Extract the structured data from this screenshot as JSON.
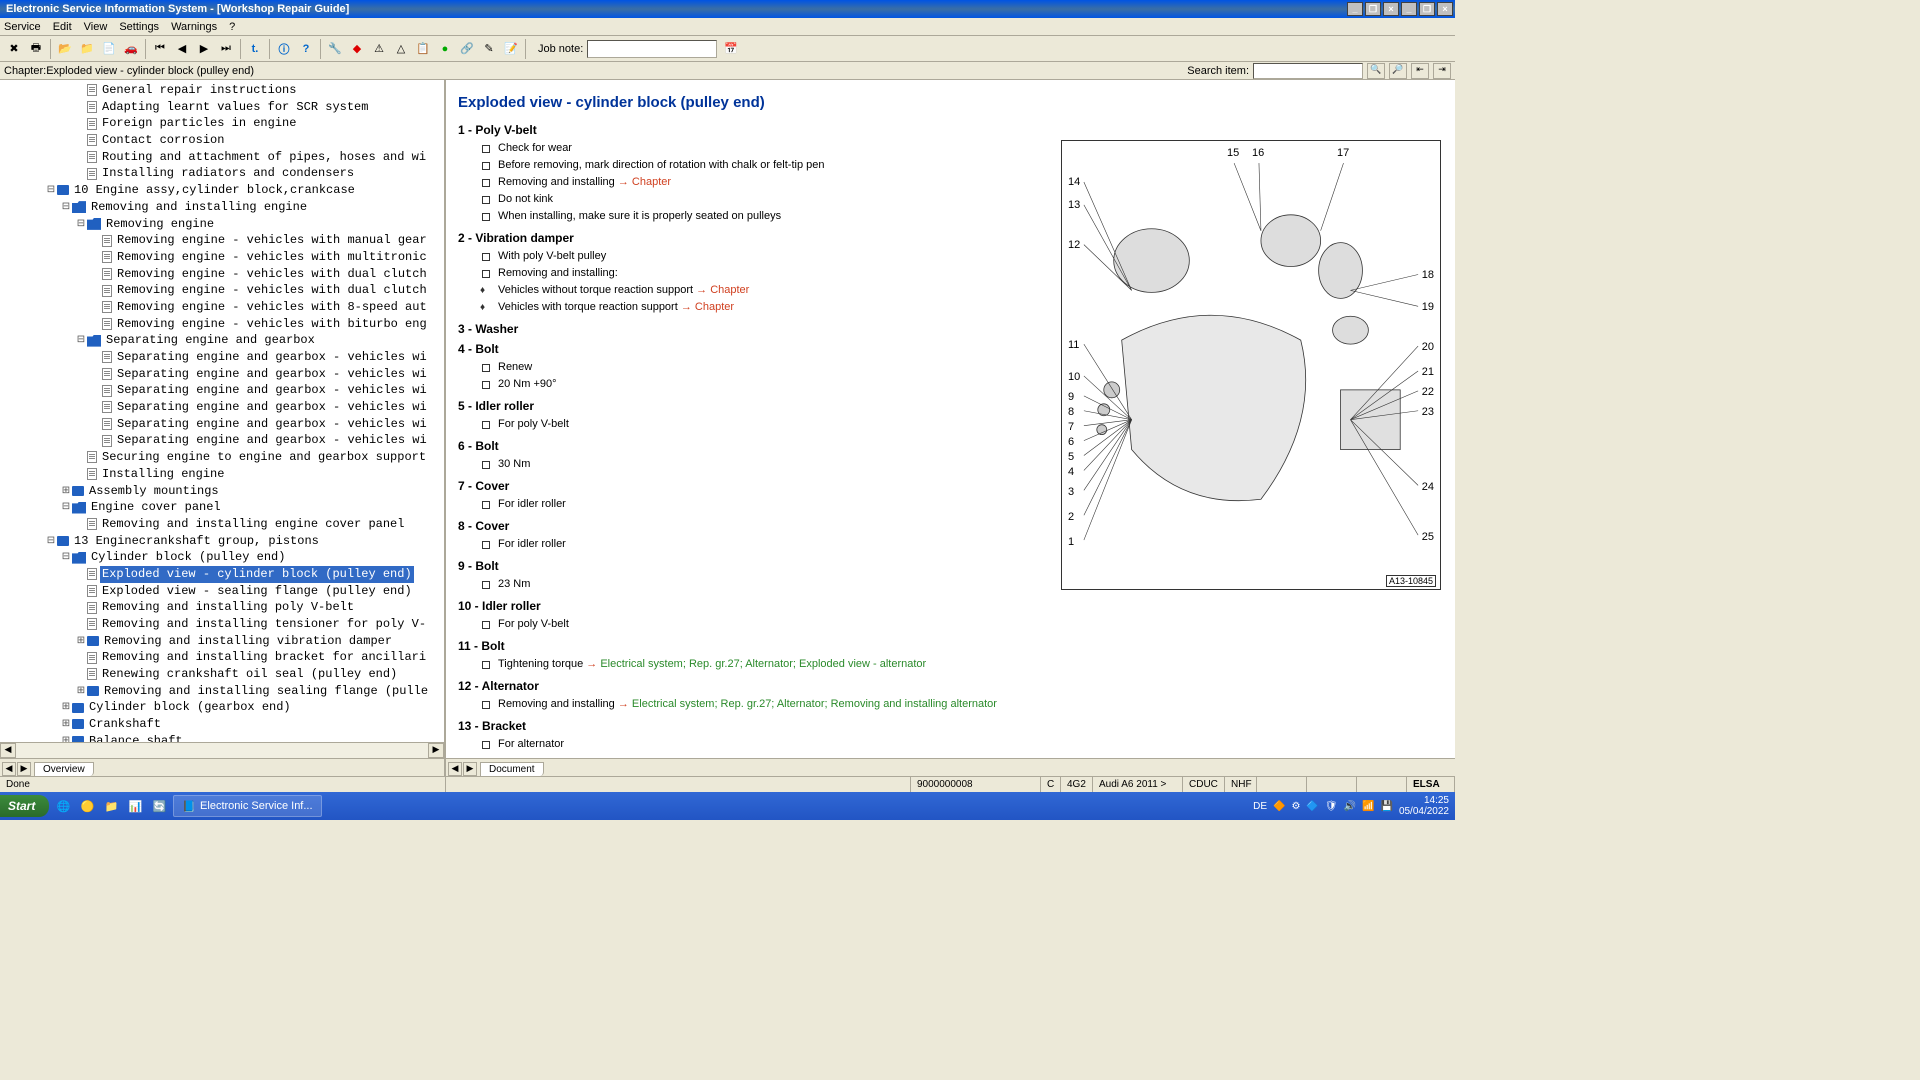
{
  "window": {
    "title": "Electronic Service Information System - [Workshop Repair Guide]"
  },
  "menu": [
    "Service",
    "Edit",
    "View",
    "Settings",
    "Warnings",
    "?"
  ],
  "toolbar": {
    "jobnote_label": "Job note:"
  },
  "chapter": {
    "label": "Chapter:Exploded view - cylinder block (pulley end)",
    "search_label": "Search item:"
  },
  "tree": [
    {
      "lvl": 3,
      "tw": "",
      "ic": "doc",
      "t": "General repair instructions"
    },
    {
      "lvl": 3,
      "tw": "",
      "ic": "doc",
      "t": "Adapting learnt values for SCR system"
    },
    {
      "lvl": 3,
      "tw": "",
      "ic": "doc",
      "t": "Foreign particles in engine"
    },
    {
      "lvl": 3,
      "tw": "",
      "ic": "doc",
      "t": "Contact corrosion"
    },
    {
      "lvl": 3,
      "tw": "",
      "ic": "doc",
      "t": "Routing and attachment of pipes, hoses and wi"
    },
    {
      "lvl": 3,
      "tw": "",
      "ic": "doc",
      "t": "Installing radiators and condensers"
    },
    {
      "lvl": 1,
      "tw": "−",
      "ic": "book",
      "t": "10 Engine assy,cylinder block,crankcase"
    },
    {
      "lvl": 2,
      "tw": "−",
      "ic": "folder",
      "t": "Removing and installing engine"
    },
    {
      "lvl": 3,
      "tw": "−",
      "ic": "folder",
      "t": "Removing engine"
    },
    {
      "lvl": 4,
      "tw": "",
      "ic": "doc",
      "t": "Removing engine - vehicles with manual gear"
    },
    {
      "lvl": 4,
      "tw": "",
      "ic": "doc",
      "t": "Removing engine - vehicles with multitronic"
    },
    {
      "lvl": 4,
      "tw": "",
      "ic": "doc",
      "t": "Removing engine - vehicles with dual clutch"
    },
    {
      "lvl": 4,
      "tw": "",
      "ic": "doc",
      "t": "Removing engine - vehicles with dual clutch"
    },
    {
      "lvl": 4,
      "tw": "",
      "ic": "doc",
      "t": "Removing engine - vehicles with 8-speed aut"
    },
    {
      "lvl": 4,
      "tw": "",
      "ic": "doc",
      "t": "Removing engine - vehicles with biturbo eng"
    },
    {
      "lvl": 3,
      "tw": "−",
      "ic": "folder",
      "t": "Separating engine and gearbox"
    },
    {
      "lvl": 4,
      "tw": "",
      "ic": "doc",
      "t": "Separating engine and gearbox - vehicles wi"
    },
    {
      "lvl": 4,
      "tw": "",
      "ic": "doc",
      "t": "Separating engine and gearbox - vehicles wi"
    },
    {
      "lvl": 4,
      "tw": "",
      "ic": "doc",
      "t": "Separating engine and gearbox - vehicles wi"
    },
    {
      "lvl": 4,
      "tw": "",
      "ic": "doc",
      "t": "Separating engine and gearbox - vehicles wi"
    },
    {
      "lvl": 4,
      "tw": "",
      "ic": "doc",
      "t": "Separating engine and gearbox - vehicles wi"
    },
    {
      "lvl": 4,
      "tw": "",
      "ic": "doc",
      "t": "Separating engine and gearbox - vehicles wi"
    },
    {
      "lvl": 3,
      "tw": "",
      "ic": "doc",
      "t": "Securing engine to engine and gearbox support"
    },
    {
      "lvl": 3,
      "tw": "",
      "ic": "doc",
      "t": "Installing engine"
    },
    {
      "lvl": 2,
      "tw": "+",
      "ic": "book",
      "t": "Assembly mountings"
    },
    {
      "lvl": 2,
      "tw": "−",
      "ic": "folder",
      "t": "Engine cover panel"
    },
    {
      "lvl": 3,
      "tw": "",
      "ic": "doc",
      "t": "Removing and installing engine cover panel"
    },
    {
      "lvl": 1,
      "tw": "−",
      "ic": "book",
      "t": "13 Enginecrankshaft group, pistons"
    },
    {
      "lvl": 2,
      "tw": "−",
      "ic": "folder",
      "t": "Cylinder block (pulley end)"
    },
    {
      "lvl": 3,
      "tw": "",
      "ic": "doc",
      "t": "Exploded view - cylinder block (pulley end)",
      "sel": true
    },
    {
      "lvl": 3,
      "tw": "",
      "ic": "doc",
      "t": "Exploded view - sealing flange (pulley end)"
    },
    {
      "lvl": 3,
      "tw": "",
      "ic": "doc",
      "t": "Removing and installing poly V-belt"
    },
    {
      "lvl": 3,
      "tw": "",
      "ic": "doc",
      "t": "Removing and installing tensioner for poly V-"
    },
    {
      "lvl": 3,
      "tw": "+",
      "ic": "book",
      "t": "Removing and installing vibration damper"
    },
    {
      "lvl": 3,
      "tw": "",
      "ic": "doc",
      "t": "Removing and installing bracket for ancillari"
    },
    {
      "lvl": 3,
      "tw": "",
      "ic": "doc",
      "t": "Renewing crankshaft oil seal (pulley end)"
    },
    {
      "lvl": 3,
      "tw": "+",
      "ic": "book",
      "t": "Removing and installing sealing flange (pulle"
    },
    {
      "lvl": 2,
      "tw": "+",
      "ic": "book",
      "t": "Cylinder block (gearbox end)"
    },
    {
      "lvl": 2,
      "tw": "+",
      "ic": "book",
      "t": "Crankshaft"
    },
    {
      "lvl": 2,
      "tw": "+",
      "ic": "book",
      "t": "Balance shaft"
    }
  ],
  "left_tab": "Overview",
  "right_tab": "Document",
  "doc": {
    "title": "Exploded view - cylinder block (pulley end)",
    "parts": [
      {
        "n": "1",
        "name": "Poly V-belt",
        "items": [
          {
            "t": "Check for wear",
            "b": "sq"
          },
          {
            "t": "Before removing, mark direction of rotation with chalk or felt-tip pen",
            "b": "sq"
          },
          {
            "t": "Removing and installing ",
            "link": "Chapter",
            "b": "sq",
            "arrow": true
          },
          {
            "t": "Do not kink",
            "b": "sq"
          },
          {
            "t": "When installing, make sure it is properly seated on pulleys",
            "b": "sq"
          }
        ]
      },
      {
        "n": "2",
        "name": "Vibration damper",
        "items": [
          {
            "t": "With poly V-belt pulley",
            "b": "sq"
          },
          {
            "t": "Removing and installing:",
            "b": "sq"
          },
          {
            "t": "Vehicles without torque reaction support ",
            "link": "Chapter",
            "b": "di",
            "arrow": true
          },
          {
            "t": "Vehicles with torque reaction support ",
            "link": "Chapter",
            "b": "di",
            "arrow": true
          }
        ]
      },
      {
        "n": "3",
        "name": "Washer",
        "items": []
      },
      {
        "n": "4",
        "name": "Bolt",
        "items": [
          {
            "t": "Renew",
            "b": "sq"
          },
          {
            "t": "20 Nm +90°",
            "b": "sq"
          }
        ]
      },
      {
        "n": "5",
        "name": "Idler roller",
        "items": [
          {
            "t": "For poly V-belt",
            "b": "sq"
          }
        ]
      },
      {
        "n": "6",
        "name": "Bolt",
        "items": [
          {
            "t": "30 Nm",
            "b": "sq"
          }
        ]
      },
      {
        "n": "7",
        "name": "Cover",
        "items": [
          {
            "t": "For idler roller",
            "b": "sq"
          }
        ]
      },
      {
        "n": "8",
        "name": "Cover",
        "items": [
          {
            "t": "For idler roller",
            "b": "sq"
          }
        ]
      },
      {
        "n": "9",
        "name": "Bolt",
        "items": [
          {
            "t": "23 Nm",
            "b": "sq"
          }
        ]
      },
      {
        "n": "10",
        "name": "Idler roller",
        "items": [
          {
            "t": "For poly V-belt",
            "b": "sq"
          }
        ]
      },
      {
        "n": "11",
        "name": "Bolt",
        "items": [
          {
            "t": "Tightening torque ",
            "link2": "Electrical system; Rep. gr.27; Alternator; Exploded view - alternator",
            "b": "sq",
            "arrow": true
          }
        ]
      },
      {
        "n": "12",
        "name": "Alternator",
        "items": [
          {
            "t": "Removing and installing ",
            "link2": "Electrical system; Rep. gr.27; Alternator; Removing and installing alternator",
            "b": "sq",
            "arrow": true
          }
        ]
      },
      {
        "n": "13",
        "name": "Bracket",
        "items": [
          {
            "t": "For alternator",
            "b": "sq"
          }
        ]
      }
    ],
    "diagram_code": "A13-10845",
    "diagram_labels_left": [
      "14",
      "13",
      "12",
      "11",
      "10",
      "9",
      "8",
      "7",
      "6",
      "5",
      "4",
      "3",
      "2",
      "1"
    ],
    "diagram_labels_top": [
      "15",
      "16",
      "17"
    ],
    "diagram_labels_right": [
      "18",
      "19",
      "20",
      "21",
      "22",
      "23",
      "24",
      "25"
    ]
  },
  "status": {
    "done": "Done",
    "cells": [
      "9000000008",
      "C",
      "4G2",
      "Audi A6 2011 >",
      "CDUC",
      "NHF",
      "",
      "",
      "",
      "ELSA"
    ]
  },
  "taskbar": {
    "start": "Start",
    "app": "Electronic Service Inf...",
    "lang": "DE",
    "time": "14:25",
    "date": "05/04/2022"
  }
}
